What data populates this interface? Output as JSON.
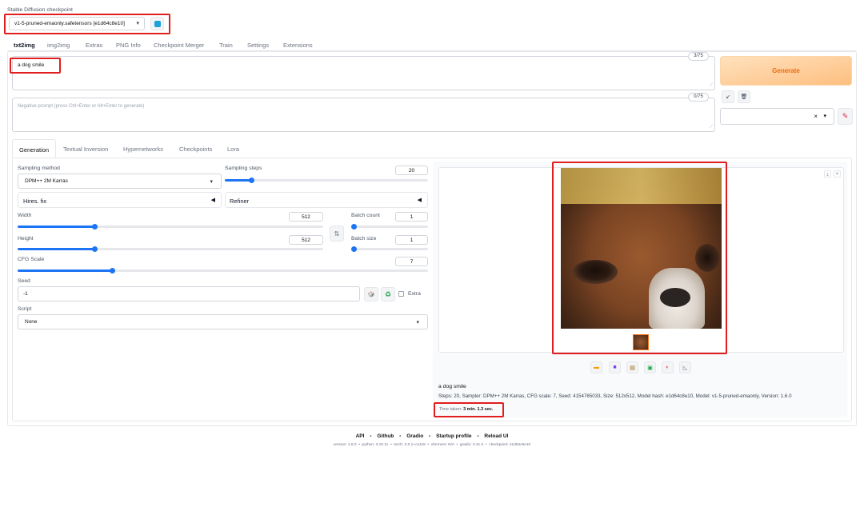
{
  "checkpoint": {
    "label": "Stable Diffusion checkpoint",
    "value": "v1-5-pruned-emaonly.safetensors [e1d64c8e10]",
    "refresh_icon": "refresh-icon"
  },
  "tabs": [
    "txt2img",
    "img2img",
    "Extras",
    "PNG Info",
    "Checkpoint Merger",
    "Train",
    "Settings",
    "Extensions"
  ],
  "prompt": {
    "value": "a dog smile",
    "counter": "3/75"
  },
  "negative": {
    "placeholder": "Negative prompt (press Ctrl+Enter or Alt+Enter to generate)",
    "counter": "0/75"
  },
  "generate": {
    "label": "Generate"
  },
  "styles": {
    "clear": "×",
    "caret": "▾"
  },
  "subtabs": [
    "Generation",
    "Textual Inversion",
    "Hypernetworks",
    "Checkpoints",
    "Lora"
  ],
  "params": {
    "sampling_method_label": "Sampling method",
    "sampling_method": "DPM++ 2M Karras",
    "sampling_steps_label": "Sampling steps",
    "sampling_steps": "20",
    "hires_label": "Hires. fix",
    "refiner_label": "Refiner",
    "width_label": "Width",
    "width": "512",
    "height_label": "Height",
    "height": "512",
    "batch_count_label": "Batch count",
    "batch_count": "1",
    "batch_size_label": "Batch size",
    "batch_size": "1",
    "cfg_label": "CFG Scale",
    "cfg": "7",
    "seed_label": "Seed",
    "seed": "-1",
    "extra_label": "Extra",
    "script_label": "Script",
    "script": "None",
    "swap_icon": "⇅"
  },
  "sliders": {
    "steps": 0.13,
    "width": 0.25,
    "height": 0.25,
    "cfg": 0.23,
    "batch_count": 0.0,
    "batch_size": 0.0
  },
  "output": {
    "prompt": "a dog smile",
    "info": "Steps: 20, Sampler: DPM++ 2M Karras, CFG scale: 7, Seed: 4154765033, Size: 512x512, Model hash: e1d64c8e10, Model: v1-5-pruned-emaonly, Version: 1.6.0",
    "time_label": "Time taken:",
    "time_value": "3 min. 1.3 sec.",
    "tools": [
      "folder-icon",
      "save-icon",
      "zip-icon",
      "send-to-img2img-icon",
      "send-to-inpaint-icon",
      "send-to-extras-icon"
    ]
  },
  "footer": {
    "links": [
      "API",
      "Github",
      "Gradio",
      "Startup profile",
      "Reload UI"
    ],
    "version_line": "version: 1.6.0  •  python: 3.10.11  •  torch: 2.0.1+cu118  •  xformers: N/A  •  gradio: 3.41.2  •  checkpoint: e1d64c8e10"
  }
}
